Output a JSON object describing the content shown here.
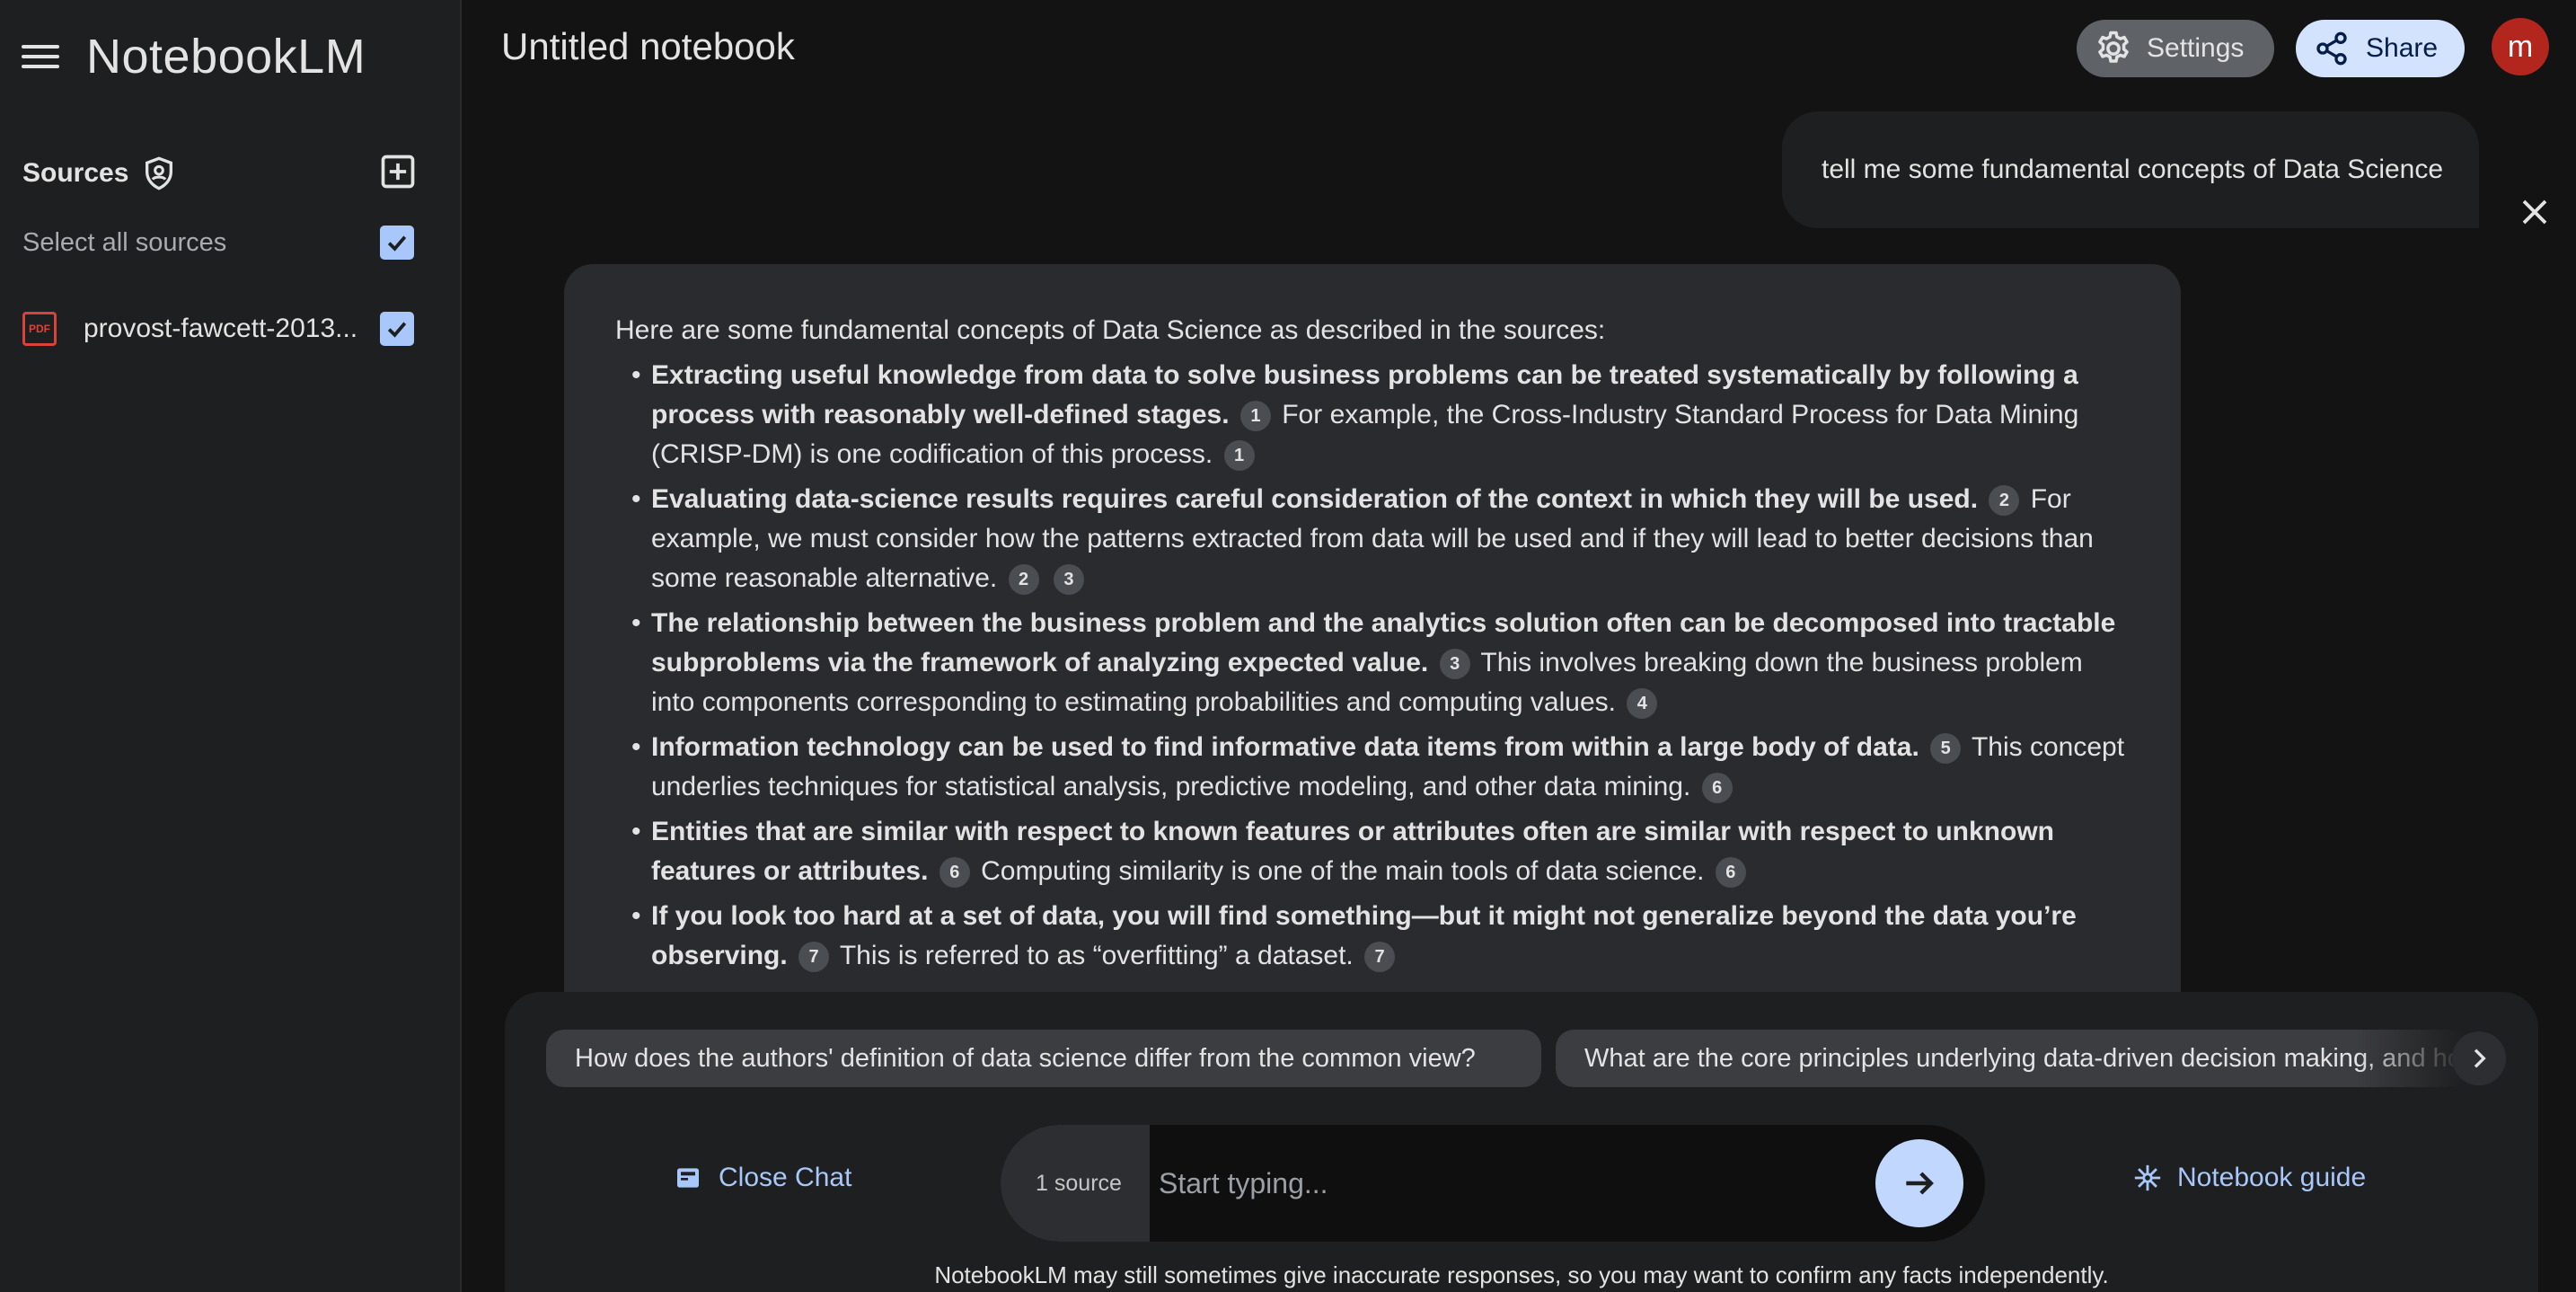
{
  "app": {
    "name": "NotebookLM"
  },
  "sidebar": {
    "sources_title": "Sources",
    "select_all_label": "Select all sources",
    "select_all_checked": true,
    "sources": [
      {
        "name": "provost-fawcett-2013...",
        "type": "PDF",
        "checked": true
      }
    ]
  },
  "header": {
    "notebook_title": "Untitled notebook",
    "settings_label": "Settings",
    "share_label": "Share",
    "avatar_initial": "m"
  },
  "chat": {
    "user_message": "tell me some fundamental concepts of Data Science",
    "answer": {
      "intro": "Here are some fundamental concepts of Data Science as described in the sources:",
      "items": [
        {
          "bold": "Extracting useful knowledge from data to solve business problems can be treated systematically by following a process with reasonably well-defined stages.",
          "bold_cites": [
            "1"
          ],
          "text": "For example, the Cross-Industry Standard Process for Data Mining (CRISP-DM) is one codification of this process.",
          "text_cites": [
            "1"
          ]
        },
        {
          "bold": "Evaluating data-science results requires careful consideration of the context in which they will be used.",
          "bold_cites": [
            "2"
          ],
          "text": "For example, we must consider how the patterns extracted from data will be used and if they will lead to better decisions than some reasonable alternative.",
          "text_cites": [
            "2",
            "3"
          ]
        },
        {
          "bold": "The relationship between the business problem and the analytics solution often can be decomposed into tractable subproblems via the framework of analyzing expected value.",
          "bold_cites": [
            "3"
          ],
          "text": "This involves breaking down the business problem into components corresponding to estimating probabilities and computing values.",
          "text_cites": [
            "4"
          ]
        },
        {
          "bold": "Information technology can be used to find informative data items from within a large body of data.",
          "bold_cites": [
            "5"
          ],
          "text": "This concept underlies techniques for statistical analysis, predictive modeling, and other data mining.",
          "text_cites": [
            "6"
          ]
        },
        {
          "bold": "Entities that are similar with respect to known features or attributes often are similar with respect to unknown features or attributes.",
          "bold_cites": [
            "6"
          ],
          "text": "Computing similarity is one of the main tools of data science.",
          "text_cites": [
            "6"
          ]
        },
        {
          "bold": "If you look too hard at a set of data, you will find something—but it might not generalize beyond the data you’re observing.",
          "bold_cites": [
            "7"
          ],
          "text": "This is referred to as “overfitting” a dataset.",
          "text_cites": [
            "7"
          ]
        }
      ]
    }
  },
  "suggestions": [
    "How does the authors' definition of data science differ from the common view?",
    "What are the core principles underlying data-driven decision making, and how do they relate to data mining?"
  ],
  "composer": {
    "source_count": "1 source",
    "placeholder": "Start typing...",
    "close_chat_label": "Close Chat",
    "guide_label": "Notebook guide"
  },
  "disclaimer": "NotebookLM may still sometimes give inaccurate responses, so you may want to confirm any facts independently.",
  "colors": {
    "background": "#131314",
    "sidebar": "#1e1f20",
    "accent": "#a8c7fa",
    "share_bg": "#d3e3fd",
    "avatar_bg": "#b3261e",
    "pdf_icon": "#d8433a"
  }
}
